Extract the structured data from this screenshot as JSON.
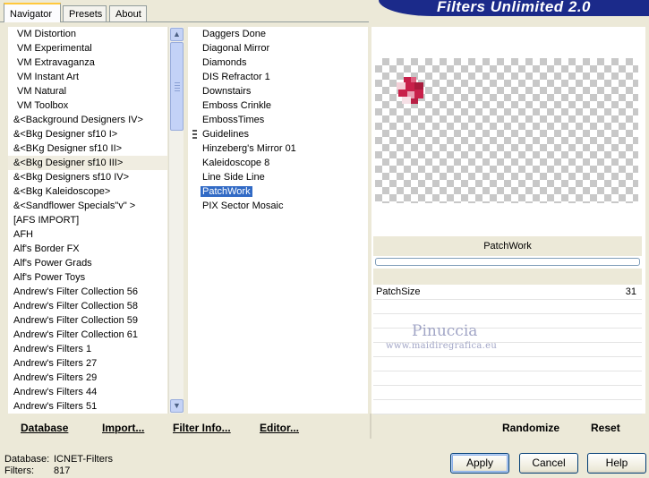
{
  "banner": {
    "title": "Filters Unlimited 2.0"
  },
  "tabs": [
    {
      "label": "Navigator",
      "active": true
    },
    {
      "label": "Presets",
      "active": false
    },
    {
      "label": "About",
      "active": false
    }
  ],
  "categories": {
    "selected_index": 9,
    "items": [
      "VM Distortion",
      "VM Experimental",
      "VM Extravaganza",
      "VM Instant Art",
      "VM Natural",
      "VM Toolbox",
      "&<Background Designers IV>",
      "&<Bkg Designer sf10 I>",
      "&<BKg Designer sf10 II>",
      "&<Bkg Designer sf10 III>",
      "&<Bkg Designers sf10 IV>",
      "&<Bkg Kaleidoscope>",
      "&<Sandflower Specials\"v\" >",
      "[AFS IMPORT]",
      "AFH",
      "Alf's Border FX",
      "Alf's Power Grads",
      "Alf's Power Toys",
      "Andrew's Filter Collection 56",
      "Andrew's Filter Collection 58",
      "Andrew's Filter Collection 59",
      "Andrew's Filter Collection 61",
      "Andrew's Filters 1",
      "Andrew's Filters 27",
      "Andrew's Filters 29",
      "Andrew's Filters 44",
      "Andrew's Filters 51"
    ]
  },
  "scrollbar": {
    "up_icon": "scroll-up-arrow",
    "down_icon": "scroll-down-arrow"
  },
  "filters": {
    "selected_index": 11,
    "marker_index": 7,
    "items": [
      "Daggers Done",
      "Diagonal Mirror",
      "Diamonds",
      "DIS Refractor 1",
      "Downstairs",
      "Emboss Crinkle",
      "EmbossTimes",
      "Guidelines",
      "Hinzeberg's Mirror 01",
      "Kaleidoscope 8",
      "Line Side Line",
      "PatchWork",
      "PIX Sector Mosaic"
    ]
  },
  "preview": {
    "accent": "#c8204a"
  },
  "filter_name": "PatchWork",
  "progress": 0,
  "parameters": [
    {
      "name": "PatchSize",
      "value": "31"
    }
  ],
  "watermark": {
    "name": "Pinuccia",
    "url": "www.maidiregrafica.eu"
  },
  "links": {
    "database": "Database",
    "import": "Import...",
    "filter_info": "Filter Info...",
    "editor": "Editor...",
    "randomize": "Randomize",
    "reset": "Reset"
  },
  "status": {
    "database_label": "Database:",
    "database_value": "ICNET-Filters",
    "filters_label": "Filters:",
    "filters_value": "817"
  },
  "buttons": {
    "apply": "Apply",
    "cancel": "Cancel",
    "help": "Help"
  }
}
